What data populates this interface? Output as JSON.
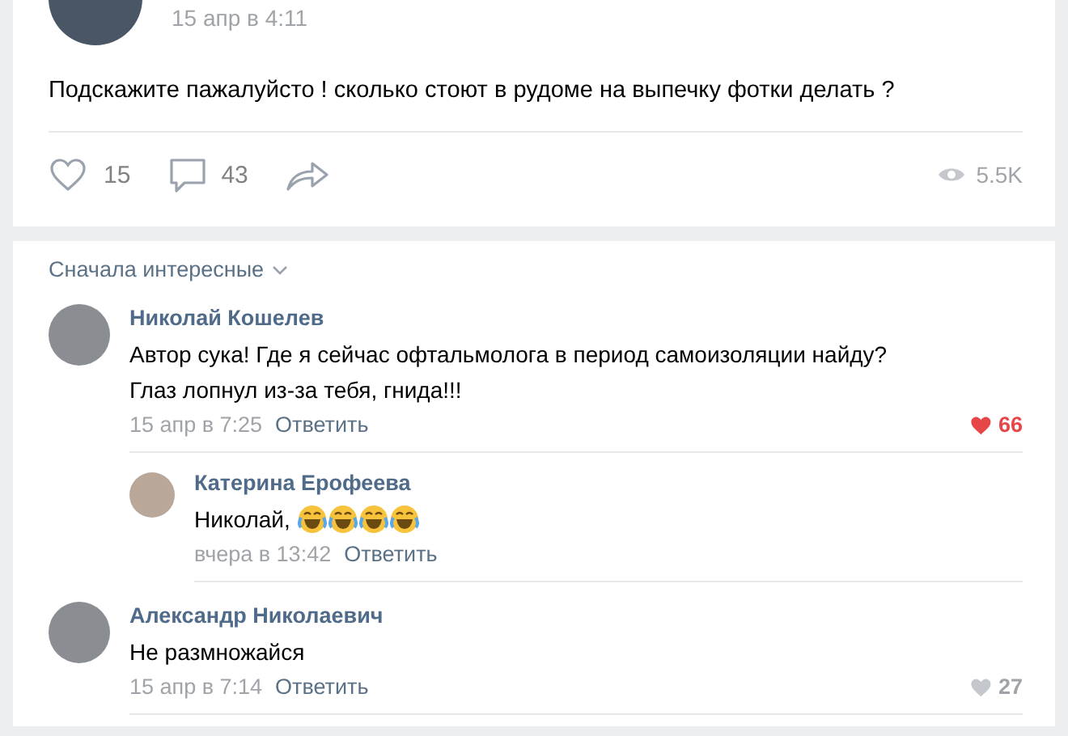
{
  "post": {
    "date": "15 апр в 4:11",
    "text": "Подскажите пажалуйсто ! сколько стоют в рудоме на выпечку фотки делать ?",
    "likes": {
      "count": "15",
      "liked": false
    },
    "comments_count": "43",
    "views": "5.5K"
  },
  "comments_sort": "Сначала интересные",
  "comments": [
    {
      "author": "Николай Кошелев",
      "text": "Автор сука! Где я сейчас офтальмолога в период самоизоляции найду? Глаз лопнул из-за тебя, гнида!!!",
      "date": "15 апр в 7:25",
      "reply": "Ответить",
      "likes": {
        "count": "66",
        "liked": true
      },
      "children": [
        {
          "author": "Катерина Ерофеева",
          "text": "Николай,",
          "emojis": [
            {
              "kind": "laughing"
            },
            {
              "kind": "laughing"
            },
            {
              "kind": "laughing"
            },
            {
              "kind": "laughing"
            }
          ],
          "date": "вчера в 13:42",
          "reply": "Ответить"
        }
      ]
    },
    {
      "author": "Александр Николаевич",
      "text": "Не размножайся",
      "date": "15 апр в 7:14",
      "reply": "Ответить",
      "likes": {
        "count": "27",
        "liked": false
      }
    }
  ]
}
